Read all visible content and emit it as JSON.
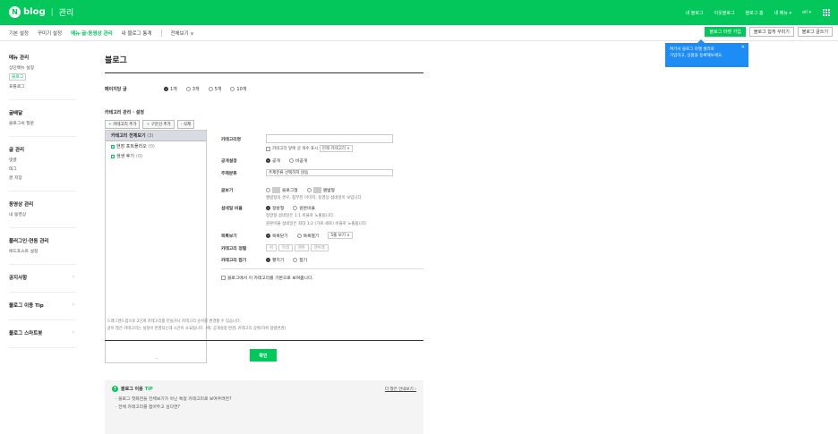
{
  "topbar": {
    "brand": "blog",
    "section": "관리",
    "nav": [
      "내 블로그",
      "이웃블로그",
      "블로그 홈",
      "내 메뉴 ▾",
      "oil ▾"
    ]
  },
  "subnav": {
    "tabs": [
      "기본 설정",
      "꾸미기 설정",
      "메뉴·글·동영상 관리",
      "내 블로그 통계",
      "전체보기 ∨"
    ],
    "buttons": [
      "블로그 마켓 가입",
      "블로그 쉽게 꾸미기",
      "블로그 글쓰기"
    ]
  },
  "tooltip": {
    "line1": "여기서 블로그 마켓 셀러로",
    "line2": "가입하고, 상품을 등록해보세요."
  },
  "sidebar": [
    {
      "title": "메뉴 관리",
      "items": [
        "상단메뉴 설정",
        "블로그",
        "프롤로그"
      ]
    },
    {
      "title": "글배달",
      "items": [
        "블로그씨 질문"
      ]
    },
    {
      "title": "글 관리",
      "items": [
        "댓글",
        "태그",
        "글 저장"
      ]
    },
    {
      "title": "동영상 관리",
      "items": [
        "내 동영상"
      ]
    },
    {
      "title": "플러그인·연동 관리",
      "items": [
        "애드포스트 설정"
      ]
    },
    {
      "title": "공지사항",
      "items": []
    },
    {
      "title": "블로그 이용 Tip",
      "items": []
    },
    {
      "title": "블로그 스마트봇",
      "items": []
    }
  ],
  "main": {
    "title": "블로그",
    "ppp_label": "페이지당 글",
    "ppp_options": [
      "1개",
      "3개",
      "5개",
      "10개"
    ],
    "cat_title": "카테고리 관리 · 설정",
    "cat_buttons": [
      "카테고리 추가",
      "구분선 추가",
      "삭제"
    ],
    "tree_root": "카테고리 전체보기",
    "tree_root_count": "(3)",
    "tree_children": [
      {
        "name": "현장 포트폴리오",
        "count": "(0)"
      },
      {
        "name": "생생 후기",
        "count": "(0)"
      }
    ],
    "form": {
      "name_label": "카테고리명",
      "show_count": "카테고리 앞에 글 개수 표시",
      "show_count_sel": "현재 카테고리 ∨",
      "public_label": "공개설정",
      "public_opts": [
        "공개",
        "비공개"
      ],
      "topic_label": "주제분류",
      "topic_sel": "주제분류 선택하지 않음",
      "view_label": "글보기",
      "view_opts": [
        "블로그형",
        "앨범형"
      ],
      "view_note": "앨범형의 경우, 첨부된 이미지, 동영상 섬네일이 보입니다.",
      "thumb_label": "섬네일 비율",
      "thumb_opts": [
        "정방형",
        "원본비율"
      ],
      "thumb_note1": "정방형 섬네일은 1:1 비율로 노출됩니다.",
      "thumb_note2": "원본비율 섬네일은 최대 1:2 (가로:세로) 비율로 노출됩니다.",
      "list_label": "목록보기",
      "list_opts": [
        "목록닫기",
        "목록열기"
      ],
      "list_sel": "5줄 보기 ∨",
      "sort_label": "카테고리 정렬",
      "sort_opts": [
        "위",
        "아래",
        "맨위",
        "맨아래"
      ],
      "fold_label": "카테고리 접기",
      "fold_opts": [
        "펼치기",
        "접기"
      ],
      "default_cat": "블로그에서 이 카테고리를 기본으로 보여줍니다."
    },
    "notes": [
      "드래그앤드랍으로 2단계 카테고리를 만들거나 카테고리 순서를 변경할 수 있습니다.",
      "글이 많은 카테고리는 설정이 반영되는데 시간이 소요됩니다. (예, 공개설정 변경, 카테고리 상위/하위 정렬변경)"
    ],
    "confirm": "확인",
    "tip": {
      "title": "블로그 이용",
      "tag": "TIP",
      "more": "더 많은 안내보기 ›",
      "items": [
        "블로그 첫화면을 전체보기가 아닌 특정 카테고리로 보여주려면?",
        "전체 카테고리를 접어두고 싶다면?"
      ]
    }
  }
}
